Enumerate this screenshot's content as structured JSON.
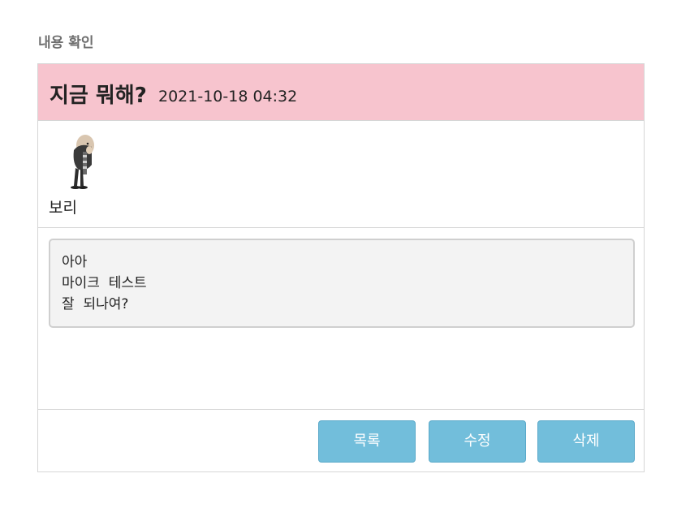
{
  "page": {
    "heading": "내용 확인"
  },
  "post": {
    "title": "지금 뭐해?",
    "date": "2021-10-18 04:32",
    "author": "보리",
    "content_lines": [
      "아아",
      "마이크  테스트",
      "잘  되나여?"
    ]
  },
  "actions": {
    "list_label": "목록",
    "edit_label": "수정",
    "delete_label": "삭제"
  },
  "colors": {
    "header_bg": "#f7c4ce",
    "button_bg": "#72bedb",
    "content_bg": "#f3f3f3"
  }
}
